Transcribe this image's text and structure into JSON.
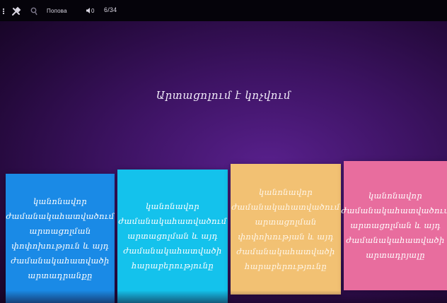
{
  "topbar": {
    "menu_icon": "dots-icon",
    "tools_icon": "wrench-icon",
    "search_icon": "search-icon",
    "title": "Попова",
    "volume_icon": "volume-icon",
    "volume_value": "0",
    "counter": "6/34"
  },
  "slide": {
    "question": "Արտացոլում է կոչվում",
    "options": [
      {
        "text": "կանոնավոր ժամանակահատվածում արտացոլման փոփոխություն և այդ ժամանակահատվածի արտադրանքը",
        "color": "#1a8ae6"
      },
      {
        "text": "կանոնավոր ժամանակահատվածում արտացոլման և այդ ժամանակահատվածի հարաբերությունը",
        "color": "#14c2ec"
      },
      {
        "text": "կանոնավոր ժամանակահատվածում արտացոլման փոփոխության և այդ ժամանակահատվածի հարաբերությունը",
        "color": "#f2c173"
      },
      {
        "text": "կանոնավոր ժամանակահատվածում արտացոլման և այդ ժամանակահատվածի արտադրյալը",
        "color": "#e86d9e"
      }
    ]
  }
}
